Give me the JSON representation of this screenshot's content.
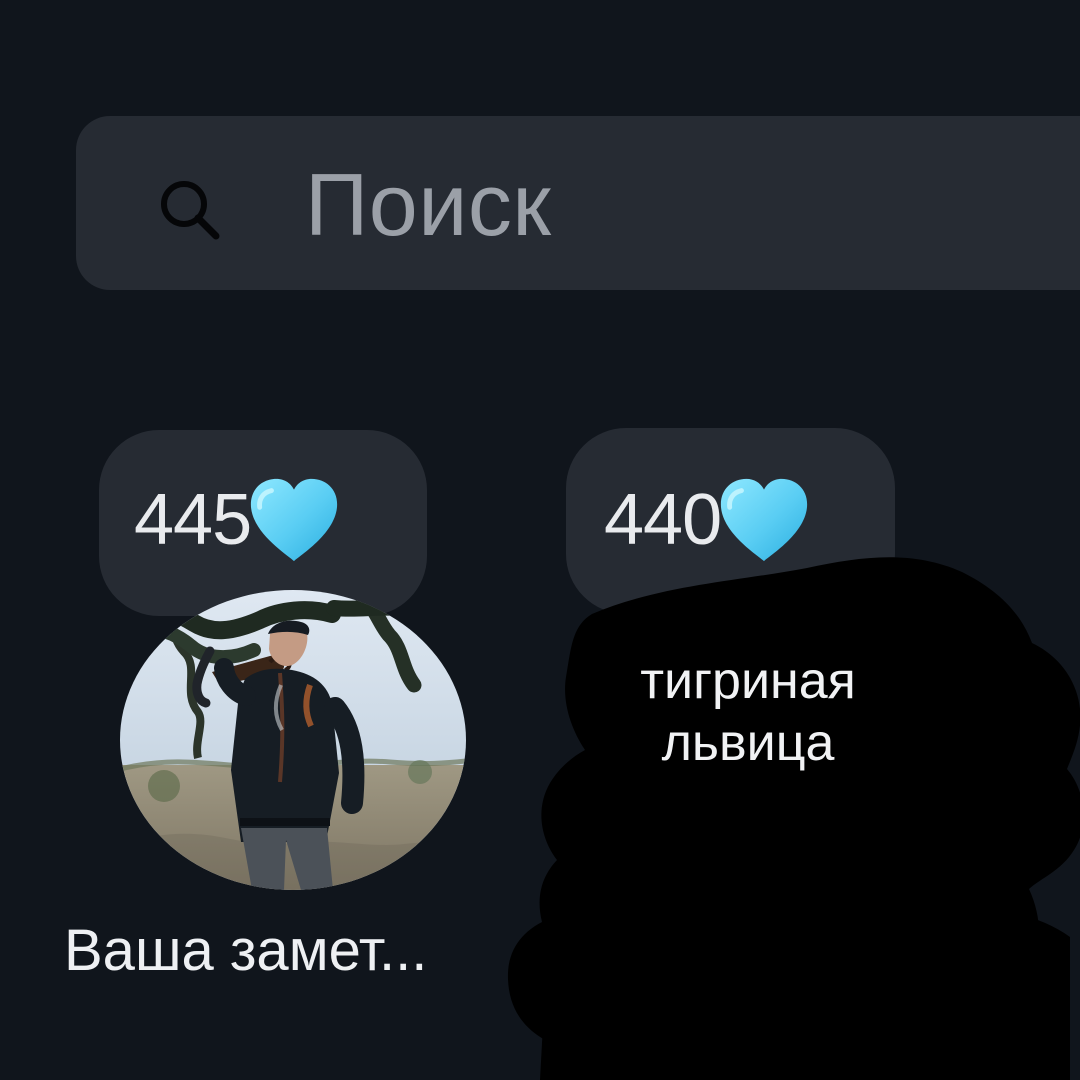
{
  "search": {
    "placeholder": "Поиск",
    "icon": "search-icon"
  },
  "notes": [
    {
      "count": "445",
      "icon": "blue-heart-icon",
      "author_label": "Ваша замет..."
    },
    {
      "count": "440",
      "icon": "blue-heart-icon",
      "author_label": "тигриная львица"
    }
  ],
  "colors": {
    "background": "#10151c",
    "surface": "#262b33",
    "placeholder_text": "#9ba0a8",
    "primary_text": "#eef0f3",
    "heart_blue": "#65cff2",
    "redaction_black": "#000000"
  }
}
